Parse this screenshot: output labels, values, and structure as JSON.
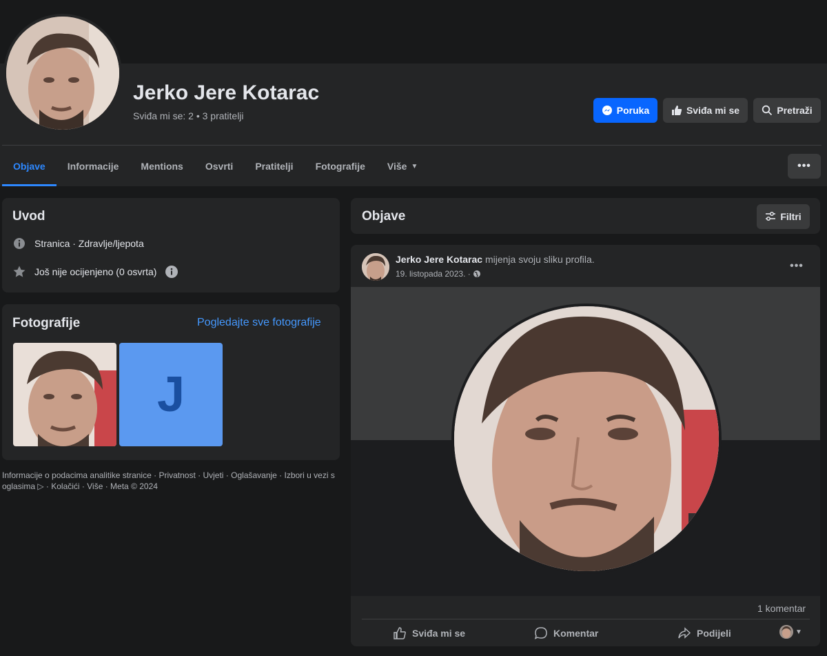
{
  "profile": {
    "name": "Jerko Jere Kotarac",
    "stats": "Sviđa mi se: 2 • 3 pratitelji",
    "avatar_icon": "profile-photo"
  },
  "actions": {
    "message_label": "Poruka",
    "like_label": "Sviđa mi se",
    "search_label": "Pretraži"
  },
  "tabs": [
    {
      "label": "Objave",
      "active": true
    },
    {
      "label": "Informacije"
    },
    {
      "label": "Mentions"
    },
    {
      "label": "Osvrti"
    },
    {
      "label": "Pratitelji"
    },
    {
      "label": "Fotografije"
    },
    {
      "label": "Više"
    }
  ],
  "intro": {
    "title": "Uvod",
    "category": "Stranica · Zdravlje/ljepota",
    "rating": "Još nije ocijenjeno (0 osvrta)"
  },
  "photos": {
    "title": "Fotografije",
    "see_all": "Pogledajte sve fotografije",
    "letter_tile": "J",
    "letter_tile_color": "#5b99f0"
  },
  "footer": {
    "text": "Informacije o podacima analitike stranice · Privatnost · Uvjeti · Oglašavanje · Izbori u vezi s oglasima ▷ · Kolačići · Više · Meta © 2024"
  },
  "posts_section": {
    "title": "Objave",
    "filter_label": "Filtri"
  },
  "post": {
    "author": "Jerko Jere Kotarac",
    "action_text": " mijenja svoju sliku profila.",
    "date": "19. listopada 2023. ·",
    "comment_count": "1 komentar",
    "like_label": "Sviđa mi se",
    "comment_label": "Komentar",
    "share_label": "Podijeli"
  },
  "colors": {
    "accent": "#2d88ff",
    "primary_button": "#0866ff",
    "surface": "#242526",
    "background": "#18191a"
  }
}
